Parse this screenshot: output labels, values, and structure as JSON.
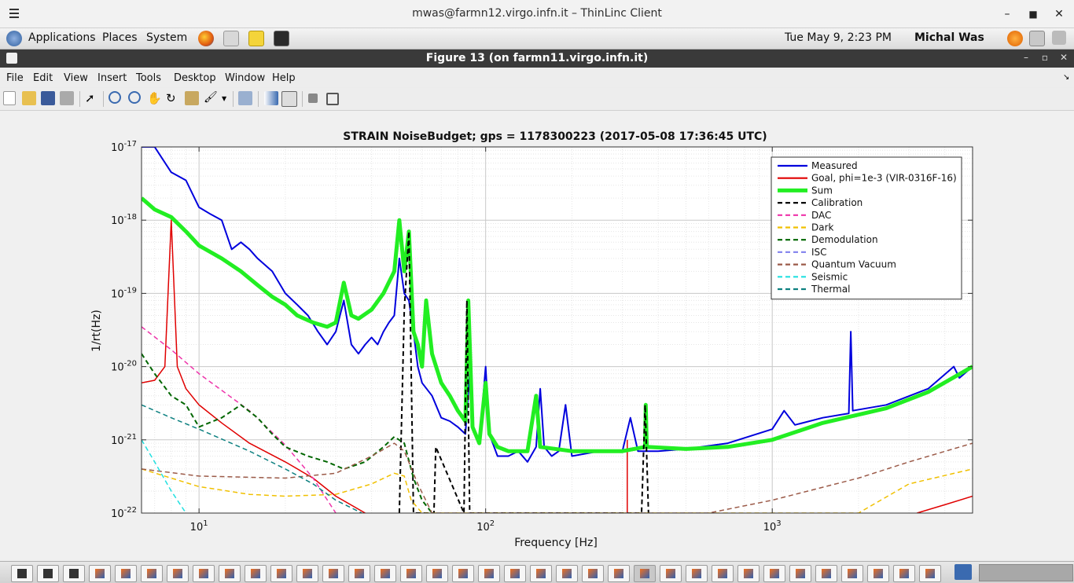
{
  "client": {
    "title": "mwas@farmn12.virgo.infn.it – ThinLinc Client"
  },
  "panel": {
    "menus": [
      "Applications",
      "Places",
      "System"
    ],
    "datetime": "Tue May  9,  2:23 PM",
    "user": "Michal Was"
  },
  "figure": {
    "window_title": "Figure 13 (on farmn11.virgo.infn.it)",
    "menus": [
      "File",
      "Edit",
      "View",
      "Insert",
      "Tools",
      "Desktop",
      "Window",
      "Help"
    ]
  },
  "colors": {
    "measured": "#0000dd",
    "goal": "#e00000",
    "sum": "#22ee22",
    "calibration": "#000000",
    "dac": "#ee33aa",
    "dark": "#f0c000",
    "demod": "#006600",
    "isc": "#8888ee",
    "quantum": "#9b5a48",
    "seismic": "#22e0e0",
    "thermal": "#0d8080"
  },
  "chart_data": {
    "type": "line",
    "title": "STRAIN NoiseBudget; gps = 1178300223 (2017-05-08 17:36:45 UTC)",
    "xlabel": "Frequency [Hz]",
    "ylabel": "1/rt(Hz)",
    "xscale": "log",
    "yscale": "log",
    "xlim": [
      6.3,
      5000
    ],
    "ylim": [
      1e-22,
      1e-17
    ],
    "xticks": [
      {
        "value": 10,
        "label": "10^1"
      },
      {
        "value": 100,
        "label": "10^2"
      },
      {
        "value": 1000,
        "label": "10^3"
      }
    ],
    "yticks": [
      {
        "value": 1e-22,
        "label": "10^-22"
      },
      {
        "value": 1e-21,
        "label": "10^-21"
      },
      {
        "value": 1e-20,
        "label": "10^-20"
      },
      {
        "value": 1e-19,
        "label": "10^-19"
      },
      {
        "value": 1e-18,
        "label": "10^-18"
      },
      {
        "value": 1e-17,
        "label": "10^-17"
      }
    ],
    "grid": true,
    "legend_position": "top-right",
    "series": [
      {
        "name": "Measured",
        "style": "solid",
        "color": "#0000dd",
        "width": 2,
        "points": [
          [
            6.3,
            1e-17
          ],
          [
            7,
            1e-17
          ],
          [
            8,
            4.5e-18
          ],
          [
            9,
            3.5e-18
          ],
          [
            10,
            1.5e-18
          ],
          [
            11,
            1.2e-18
          ],
          [
            12,
            1e-18
          ],
          [
            13,
            4e-19
          ],
          [
            14,
            5e-19
          ],
          [
            15,
            4e-19
          ],
          [
            16,
            3e-19
          ],
          [
            18,
            2e-19
          ],
          [
            20,
            1e-19
          ],
          [
            22,
            7e-20
          ],
          [
            24,
            5e-20
          ],
          [
            26,
            3e-20
          ],
          [
            28,
            2e-20
          ],
          [
            30,
            3e-20
          ],
          [
            32,
            8e-20
          ],
          [
            34,
            2e-20
          ],
          [
            36,
            1.5e-20
          ],
          [
            38,
            2e-20
          ],
          [
            40,
            2.5e-20
          ],
          [
            42,
            2e-20
          ],
          [
            44,
            3e-20
          ],
          [
            46,
            4e-20
          ],
          [
            48,
            5e-20
          ],
          [
            50,
            3e-19
          ],
          [
            52,
            1e-19
          ],
          [
            54,
            8e-20
          ],
          [
            56,
            3e-20
          ],
          [
            58,
            1e-20
          ],
          [
            60,
            6e-21
          ],
          [
            65,
            4e-21
          ],
          [
            70,
            2e-21
          ],
          [
            75,
            1.8e-21
          ],
          [
            80,
            1.5e-21
          ],
          [
            85,
            1.2e-21
          ],
          [
            88,
            8e-21
          ],
          [
            90,
            1.5e-21
          ],
          [
            95,
            9e-22
          ],
          [
            100,
            1e-20
          ],
          [
            103,
            1.2e-21
          ],
          [
            110,
            6e-22
          ],
          [
            120,
            6e-22
          ],
          [
            130,
            7e-22
          ],
          [
            140,
            5e-22
          ],
          [
            150,
            8e-22
          ],
          [
            155,
            5e-21
          ],
          [
            160,
            8e-22
          ],
          [
            170,
            6e-22
          ],
          [
            180,
            7e-22
          ],
          [
            190,
            3e-21
          ],
          [
            200,
            6e-22
          ],
          [
            250,
            7e-22
          ],
          [
            300,
            7e-22
          ],
          [
            320,
            2e-21
          ],
          [
            340,
            7e-22
          ],
          [
            400,
            7e-22
          ],
          [
            500,
            7.5e-22
          ],
          [
            700,
            9e-22
          ],
          [
            1000,
            1.4e-21
          ],
          [
            1100,
            2.5e-21
          ],
          [
            1200,
            1.6e-21
          ],
          [
            1500,
            2e-21
          ],
          [
            1850,
            2.3e-21
          ],
          [
            1880,
            3e-20
          ],
          [
            1910,
            2.5e-21
          ],
          [
            2500,
            3e-21
          ],
          [
            3500,
            5e-21
          ],
          [
            4300,
            1e-20
          ],
          [
            4500,
            7e-21
          ],
          [
            5000,
            1e-20
          ]
        ]
      },
      {
        "name": "Goal, phi=1e-3 (VIR-0316F-16)",
        "style": "solid",
        "color": "#e00000",
        "width": 1.5,
        "points": [
          [
            6.3,
            6e-21
          ],
          [
            7,
            6.5e-21
          ],
          [
            7.6,
            1e-20
          ],
          [
            8,
            1e-18
          ],
          [
            8.4,
            1e-20
          ],
          [
            9,
            5e-21
          ],
          [
            10,
            3e-21
          ],
          [
            12,
            1.7e-21
          ],
          [
            15,
            9e-22
          ],
          [
            20,
            5e-22
          ],
          [
            25,
            3e-22
          ],
          [
            30,
            1.7e-22
          ],
          [
            38,
            1e-22
          ]
        ]
      },
      {
        "name": "Goal-high",
        "legend": false,
        "style": "solid",
        "color": "#e00000",
        "width": 1.5,
        "points": [
          [
            3200,
            1e-22
          ],
          [
            4000,
            1.3e-22
          ],
          [
            5000,
            1.7e-22
          ]
        ]
      },
      {
        "name": "Goal-line",
        "legend": false,
        "style": "solid",
        "color": "#e00000",
        "width": 1.5,
        "points": [
          [
            312,
            1e-22
          ],
          [
            312,
            1e-21
          ]
        ]
      },
      {
        "name": "Sum",
        "style": "solid",
        "color": "#22ee22",
        "width": 5,
        "points": [
          [
            6.3,
            2e-18
          ],
          [
            7,
            1.4e-18
          ],
          [
            8,
            1.1e-18
          ],
          [
            9,
            7e-19
          ],
          [
            10,
            4.5e-19
          ],
          [
            12,
            3e-19
          ],
          [
            14,
            2e-19
          ],
          [
            16,
            1.3e-19
          ],
          [
            18,
            9e-20
          ],
          [
            20,
            7e-20
          ],
          [
            22,
            5e-20
          ],
          [
            25,
            4e-20
          ],
          [
            28,
            3.5e-20
          ],
          [
            30,
            4e-20
          ],
          [
            32,
            1.4e-19
          ],
          [
            34,
            5e-20
          ],
          [
            36,
            4.5e-20
          ],
          [
            40,
            6e-20
          ],
          [
            44,
            1e-19
          ],
          [
            48,
            2e-19
          ],
          [
            50,
            1e-18
          ],
          [
            52,
            2e-19
          ],
          [
            54,
            7e-19
          ],
          [
            56,
            3e-20
          ],
          [
            58,
            2e-20
          ],
          [
            60,
            1e-20
          ],
          [
            62,
            8e-20
          ],
          [
            65,
            1.5e-20
          ],
          [
            70,
            6e-21
          ],
          [
            75,
            4e-21
          ],
          [
            80,
            2.5e-21
          ],
          [
            85,
            1.8e-21
          ],
          [
            87,
            8e-20
          ],
          [
            90,
            1.5e-21
          ],
          [
            95,
            9e-22
          ],
          [
            100,
            6e-21
          ],
          [
            103,
            1.2e-21
          ],
          [
            110,
            8e-22
          ],
          [
            120,
            7e-22
          ],
          [
            140,
            7e-22
          ],
          [
            150,
            4e-21
          ],
          [
            155,
            8e-22
          ],
          [
            200,
            7e-22
          ],
          [
            300,
            7e-22
          ],
          [
            360,
            8e-22
          ],
          [
            362,
            3e-21
          ],
          [
            365,
            8e-22
          ],
          [
            500,
            7.5e-22
          ],
          [
            700,
            8e-22
          ],
          [
            1000,
            1e-21
          ],
          [
            1500,
            1.7e-21
          ],
          [
            2500,
            2.7e-21
          ],
          [
            3500,
            4.5e-21
          ],
          [
            5000,
            1e-20
          ]
        ]
      },
      {
        "name": "Calibration",
        "style": "dash",
        "color": "#000000",
        "width": 2,
        "points": [
          [
            50,
            1e-22
          ],
          [
            52,
            6e-20
          ],
          [
            54,
            7e-19
          ],
          [
            56,
            1e-22
          ],
          [
            66,
            1e-22
          ],
          [
            67,
            8e-22
          ],
          [
            84,
            1e-22
          ],
          [
            86,
            8e-20
          ],
          [
            88,
            1e-22
          ],
          [
            350,
            1e-22
          ],
          [
            360,
            3e-21
          ],
          [
            370,
            1e-22
          ]
        ]
      },
      {
        "name": "DAC",
        "style": "dash",
        "color": "#ee33aa",
        "width": 1.5,
        "points": [
          [
            6.3,
            3.5e-20
          ],
          [
            8,
            1.7e-20
          ],
          [
            10,
            8e-21
          ],
          [
            15,
            2.5e-21
          ],
          [
            20,
            8.5e-22
          ],
          [
            25,
            3e-22
          ],
          [
            30,
            1e-22
          ]
        ]
      },
      {
        "name": "Dark",
        "style": "dash",
        "color": "#f0c000",
        "width": 1.5,
        "points": [
          [
            6.3,
            4e-22
          ],
          [
            8,
            3e-22
          ],
          [
            10,
            2.3e-22
          ],
          [
            15,
            1.8e-22
          ],
          [
            20,
            1.7e-22
          ],
          [
            30,
            1.8e-22
          ],
          [
            40,
            2.5e-22
          ],
          [
            48,
            3.5e-22
          ],
          [
            52,
            3.2e-22
          ],
          [
            55,
            1.5e-22
          ],
          [
            60,
            1e-22
          ],
          [
            2000,
            1e-22
          ],
          [
            3000,
            2.5e-22
          ],
          [
            5000,
            4e-22
          ]
        ]
      },
      {
        "name": "Demodulation",
        "style": "dash",
        "color": "#006600",
        "width": 2,
        "points": [
          [
            6.3,
            1.5e-20
          ],
          [
            7,
            8e-21
          ],
          [
            8,
            4e-21
          ],
          [
            9,
            3e-21
          ],
          [
            10,
            1.5e-21
          ],
          [
            12,
            2e-21
          ],
          [
            14,
            3e-21
          ],
          [
            16,
            2e-21
          ],
          [
            18,
            1.2e-21
          ],
          [
            20,
            8e-22
          ],
          [
            24,
            6e-22
          ],
          [
            28,
            5e-22
          ],
          [
            32,
            4e-22
          ],
          [
            38,
            5e-22
          ],
          [
            44,
            8e-22
          ],
          [
            48,
            1.1e-21
          ],
          [
            52,
            9e-22
          ],
          [
            56,
            3e-22
          ],
          [
            60,
            1.5e-22
          ],
          [
            65,
            1e-22
          ]
        ]
      },
      {
        "name": "ISC",
        "style": "dash",
        "color": "#8888ee",
        "width": 1.5,
        "points": []
      },
      {
        "name": "Quantum Vacuum",
        "style": "dash",
        "color": "#9b5a48",
        "width": 1.5,
        "points": [
          [
            6.3,
            4e-22
          ],
          [
            10,
            3.2e-22
          ],
          [
            20,
            3e-22
          ],
          [
            30,
            3.5e-22
          ],
          [
            40,
            6e-22
          ],
          [
            48,
            9e-22
          ],
          [
            52,
            7e-22
          ],
          [
            58,
            2.5e-22
          ],
          [
            65,
            1e-22
          ],
          [
            600,
            1e-22
          ],
          [
            1000,
            1.5e-22
          ],
          [
            2000,
            3e-22
          ],
          [
            3000,
            5e-22
          ],
          [
            5000,
            9e-22
          ]
        ]
      },
      {
        "name": "Seismic",
        "style": "dash",
        "color": "#22e0e0",
        "width": 1.5,
        "points": [
          [
            6.3,
            1e-21
          ],
          [
            7,
            5e-22
          ],
          [
            8,
            2e-22
          ],
          [
            9,
            1e-22
          ]
        ]
      },
      {
        "name": "Thermal",
        "style": "dash",
        "color": "#0d8080",
        "width": 1.5,
        "points": [
          [
            6.3,
            3e-21
          ],
          [
            8,
            2e-21
          ],
          [
            10,
            1.4e-21
          ],
          [
            15,
            7e-22
          ],
          [
            20,
            4e-22
          ],
          [
            25,
            2.5e-22
          ],
          [
            30,
            1.5e-22
          ],
          [
            37,
            1e-22
          ]
        ]
      }
    ]
  },
  "taskbar": {
    "count": 36
  }
}
